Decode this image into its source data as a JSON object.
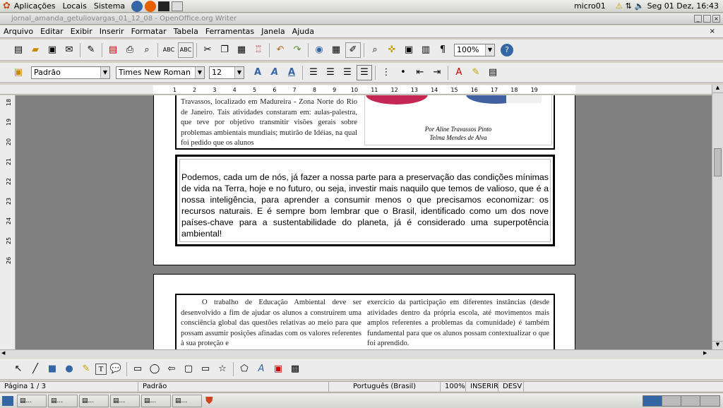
{
  "gnome": {
    "menus": [
      "Aplicações",
      "Locais",
      "Sistema"
    ],
    "user": "micro01",
    "clock": "Seg 01 Dez, 16:43"
  },
  "window": {
    "title": "jornal_amanda_getuliovargas_01_12_08 - OpenOffice.org Writer"
  },
  "menubar": [
    "Arquivo",
    "Editar",
    "Exibir",
    "Inserir",
    "Formatar",
    "Tabela",
    "Ferramentas",
    "Janela",
    "Ajuda"
  ],
  "toolbar": {
    "zoom": "100%"
  },
  "format": {
    "style": "Padrão",
    "font": "Times New Roman",
    "size": "12"
  },
  "ruler": {
    "marks": [
      "1",
      "2",
      "3",
      "4",
      "5",
      "6",
      "7",
      "8",
      "9",
      "10",
      "11",
      "12",
      "13",
      "14",
      "15",
      "16",
      "17",
      "18",
      "19"
    ]
  },
  "vruler": {
    "marks": [
      "18",
      "19",
      "20",
      "21",
      "22",
      "23",
      "24",
      "25",
      "26"
    ]
  },
  "page1": {
    "left_text": "Travassos, localizado em Madureira - Zona Norte do Rio de Janeiro. Tais atividades constaram em: aulas-palestra, que teve por objetivo transmitir visões gerais sobre problemas ambientais mundiais; mutirão de Idéias, na qual foi pedido que os alunos",
    "caption1": "Por Aline Travassos Pinto",
    "caption2": "Telma Mendes de Alva",
    "box_text": "Podemos, cada um de nós, já fazer a nossa parte para a preservação das condições mínimas de vida na Terra, hoje e no futuro, ou seja, investir mais naquilo que temos de valioso, que é a nossa inteligência, para aprender a consumir menos o que precisamos economizar: os recursos naturais. E é sempre bom lembrar que o Brasil, identificado como um dos nove países-chave para a sustentabilidade do planeta, já é considerado uma superpotência ambiental!"
  },
  "page2": {
    "left_text": "O trabalho de Educação Ambiental deve ser desenvolvido a fim de ajudar os alunos a construírem uma consciência global das questões relativas ao meio para que possam assumir posições afinadas com os valores referentes à sua proteção e",
    "right_text": "exercício da participação em diferentes instâncias (desde atividades dentro da própria escola, até movimentos mais amplos referentes a problemas da comunidade) é também fundamental para que os alunos possam contextualizar o que foi aprendido."
  },
  "status": {
    "page": "Página 1 / 3",
    "style": "Padrão",
    "language": "Português (Brasil)",
    "zoom": "100%",
    "insert": "INSERIR",
    "select": "DESV"
  },
  "taskbar": {
    "items": [
      "...",
      "...",
      "...",
      "...",
      "...",
      "..."
    ]
  }
}
